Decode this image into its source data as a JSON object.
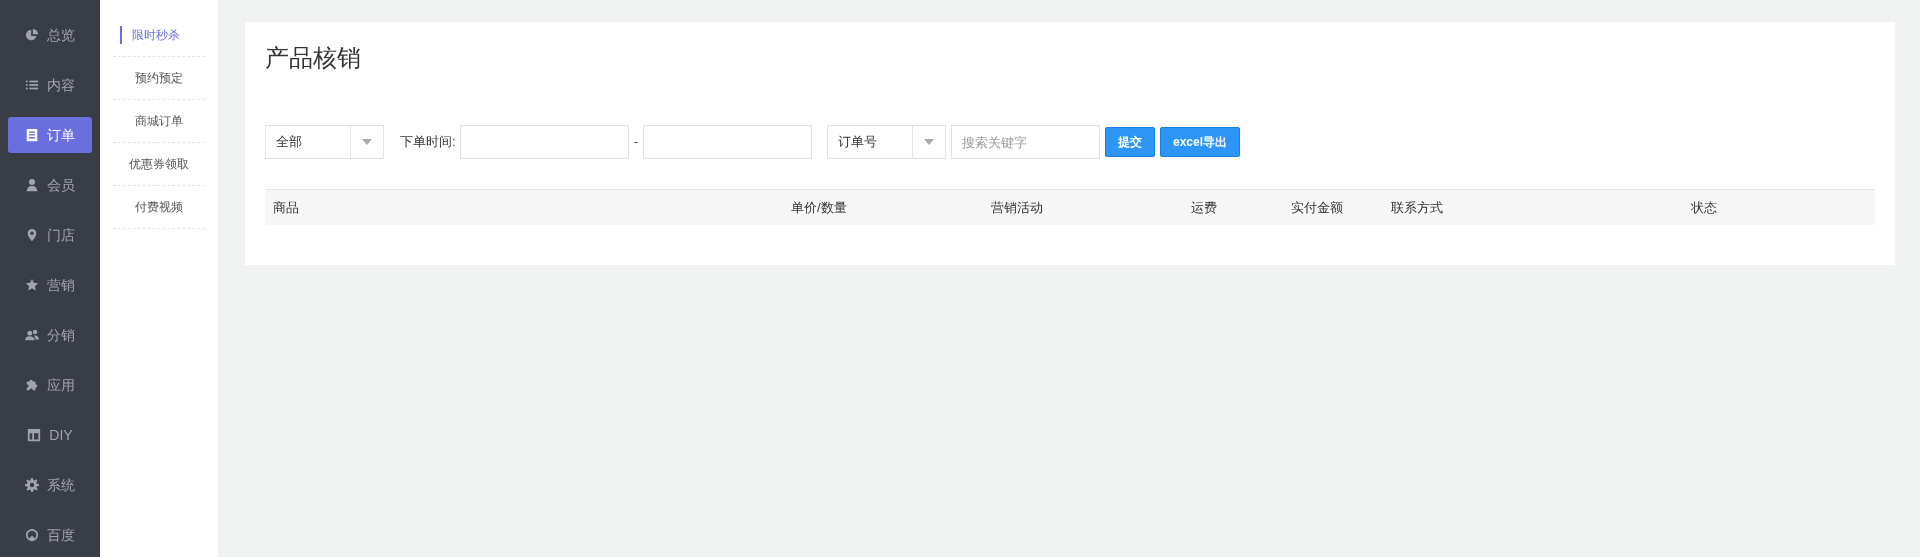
{
  "sidebar": {
    "items": [
      {
        "label": "总览",
        "selected": false
      },
      {
        "label": "内容",
        "selected": false
      },
      {
        "label": "订单",
        "selected": true
      },
      {
        "label": "会员",
        "selected": false
      },
      {
        "label": "门店",
        "selected": false
      },
      {
        "label": "营销",
        "selected": false
      },
      {
        "label": "分销",
        "selected": false
      },
      {
        "label": "应用",
        "selected": false
      },
      {
        "label": "DIY",
        "selected": false
      },
      {
        "label": "系统",
        "selected": false
      },
      {
        "label": "百度",
        "selected": false
      }
    ]
  },
  "submenu": {
    "items": [
      {
        "label": "限时秒杀",
        "selected": true
      },
      {
        "label": "预约预定",
        "selected": false
      },
      {
        "label": "商城订单",
        "selected": false
      },
      {
        "label": "优惠券领取",
        "selected": false
      },
      {
        "label": "付费视频",
        "selected": false
      }
    ]
  },
  "page": {
    "title": "产品核销",
    "filters": {
      "status_select": "全部",
      "time_label": "下单时间:",
      "range_separator": "-",
      "field_select": "订单号",
      "search_placeholder": "搜索关键字",
      "buttons": [
        "提交",
        "excel导出"
      ]
    },
    "table": {
      "columns": [
        "商品",
        "单价/数量",
        "营销活动",
        "运费",
        "实付金额",
        "联系方式",
        "状态"
      ]
    }
  }
}
